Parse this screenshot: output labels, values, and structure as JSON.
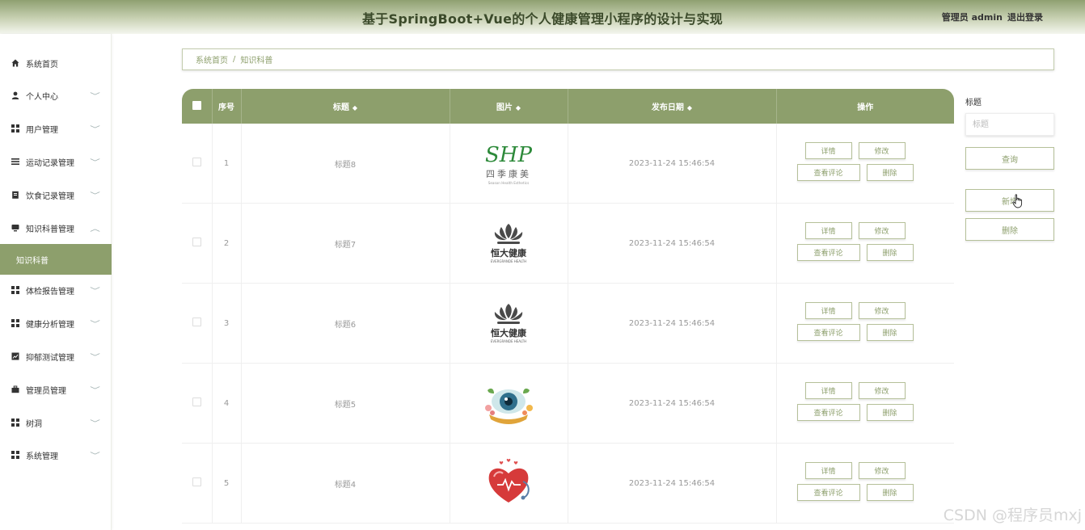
{
  "header": {
    "title": "基于SpringBoot+Vue的个人健康管理小程序的设计与实现",
    "user_label": "管理员 admin",
    "logout_label": "退出登录"
  },
  "sidebar": {
    "items": [
      {
        "label": "系统首页",
        "icon": "home-icon",
        "arrow": ""
      },
      {
        "label": "个人中心",
        "icon": "user-icon",
        "arrow": "v"
      },
      {
        "label": "用户管理",
        "icon": "grid-icon",
        "arrow": "v"
      },
      {
        "label": "运动记录管理",
        "icon": "list-icon",
        "arrow": "v"
      },
      {
        "label": "饮食记录管理",
        "icon": "clipboard-icon",
        "arrow": "v"
      },
      {
        "label": "知识科普管理",
        "icon": "monitor-icon",
        "arrow": "^"
      },
      {
        "label": "体检报告管理",
        "icon": "grid-icon",
        "arrow": "v"
      },
      {
        "label": "健康分析管理",
        "icon": "grid-icon",
        "arrow": "v"
      },
      {
        "label": "抑郁测试管理",
        "icon": "chart-icon",
        "arrow": "v"
      },
      {
        "label": "管理员管理",
        "icon": "briefcase-icon",
        "arrow": "v"
      },
      {
        "label": "树洞",
        "icon": "grid-icon",
        "arrow": "v"
      },
      {
        "label": "系统管理",
        "icon": "grid-icon",
        "arrow": "v"
      }
    ],
    "active_sub": "知识科普"
  },
  "breadcrumb": {
    "home": "系统首页",
    "separator": "/",
    "current": "知识科普"
  },
  "table": {
    "headers": {
      "index": "序号",
      "title": "标题",
      "image": "图片",
      "date": "发布日期",
      "actions": "操作"
    },
    "sort_icon": "◆",
    "rows": [
      {
        "index": "1",
        "title": "标题8",
        "date": "2023-11-24 15:46:54",
        "logo": "sjkm",
        "logo_text": "四季康美",
        "logo_sub": "Season Health Esthetics"
      },
      {
        "index": "2",
        "title": "标题7",
        "date": "2023-11-24 15:46:54",
        "logo": "evergrande",
        "logo_text": "恒大健康",
        "logo_sub": "EVERGRANDE HEALTH"
      },
      {
        "index": "3",
        "title": "标题6",
        "date": "2023-11-24 15:46:54",
        "logo": "evergrande",
        "logo_text": "恒大健康",
        "logo_sub": "EVERGRANDE HEALTH"
      },
      {
        "index": "4",
        "title": "标题5",
        "date": "2023-11-24 15:46:54",
        "logo": "eye",
        "logo_text": "",
        "logo_sub": ""
      },
      {
        "index": "5",
        "title": "标题4",
        "date": "2023-11-24 15:46:54",
        "logo": "heart",
        "logo_text": "",
        "logo_sub": ""
      }
    ],
    "actions": {
      "detail": "详情",
      "edit": "修改",
      "comment": "查看评论",
      "delete": "删除"
    }
  },
  "search": {
    "label": "标题",
    "placeholder": "标题",
    "query_label": "查询",
    "add_label": "新增",
    "delete_label": "删除"
  },
  "watermark": "CSDN @程序员mxj",
  "colors": {
    "accent": "#8d9f6c",
    "header_dark": "#3b4a2a"
  }
}
